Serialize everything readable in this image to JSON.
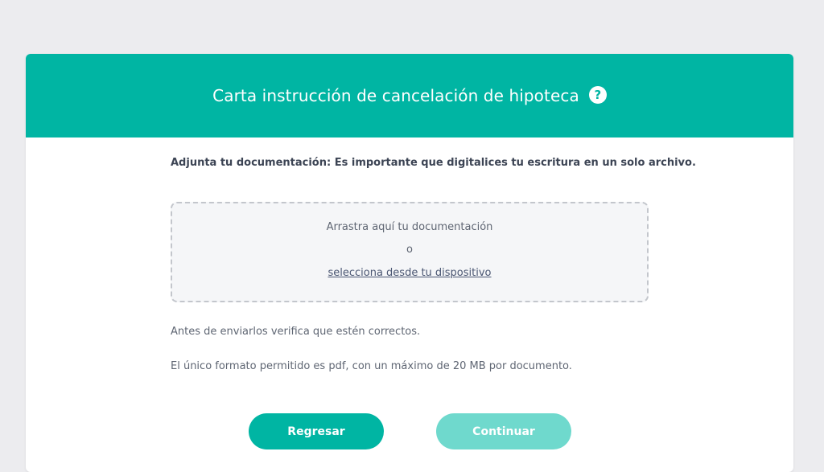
{
  "header": {
    "title": "Carta instrucción de cancelación de hipoteca",
    "help_icon": "?"
  },
  "instruction": "Adjunta tu documentación: Es importante que digitalices tu escritura en un solo archivo.",
  "dropzone": {
    "drag_text": "Arrastra aquí tu documentación",
    "or_text": "o",
    "select_link": "selecciona desde tu dispositivo"
  },
  "notes": {
    "verify": "Antes de enviarlos verifica que estén correctos.",
    "format": "El único formato permitido es pdf, con un máximo de 20 MB por documento."
  },
  "buttons": {
    "back_label": "Regresar",
    "continue_label": "Continuar"
  },
  "colors": {
    "accent": "#00b5a3",
    "accent_disabled": "#6fd9cd",
    "background": "#ececef"
  }
}
